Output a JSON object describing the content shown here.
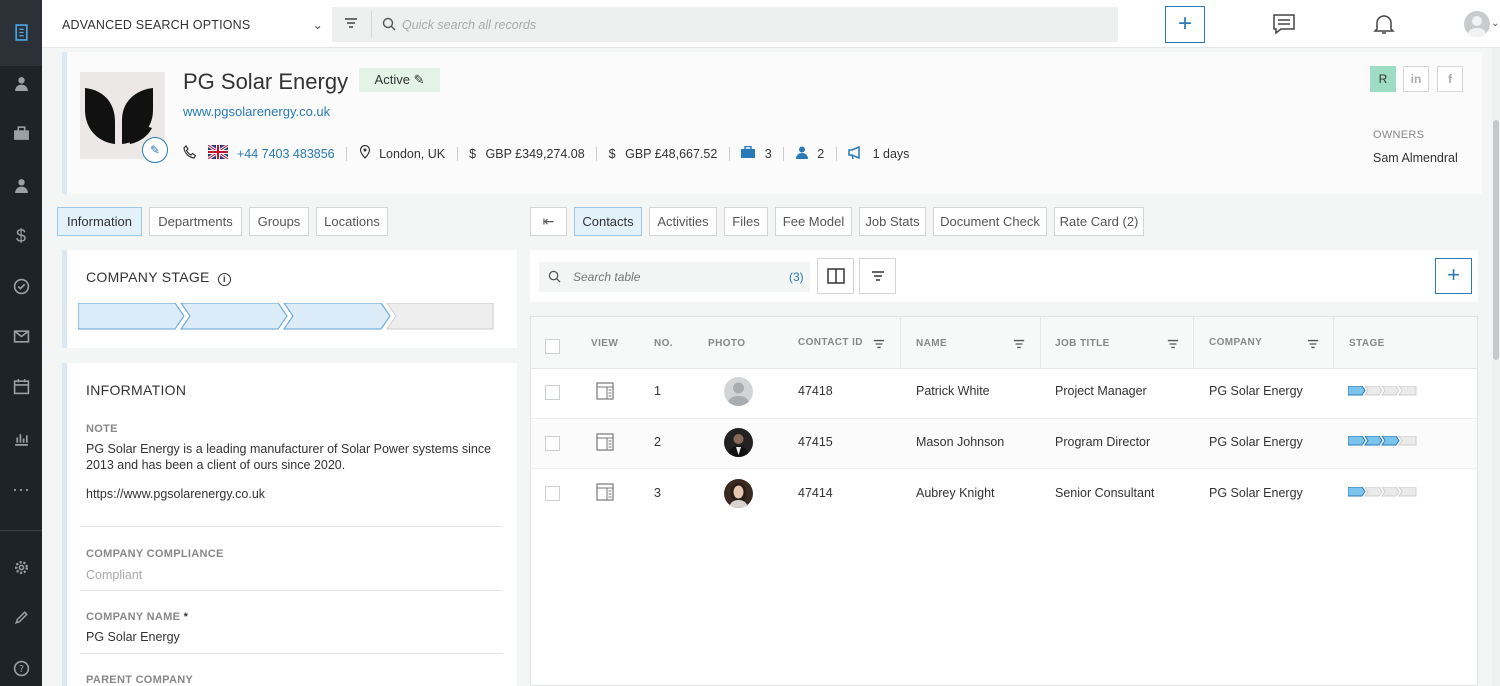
{
  "topbar": {
    "advanced_label": "ADVANCED SEARCH OPTIONS",
    "search_placeholder": "Quick search all records"
  },
  "company": {
    "name": "PG Solar Energy",
    "status": "Active",
    "website": "www.pgsolarenergy.co.uk",
    "phone": "+44 7403 483856",
    "location": "London, UK",
    "value1": "GBP £349,274.08",
    "value2": "GBP £48,667.52",
    "jobs_count": "3",
    "contacts_count": "2",
    "days": "1 days",
    "social_r": "R",
    "social_li": "in",
    "social_fb": "f",
    "owners_label": "OWNERS",
    "owner": "Sam Almendral"
  },
  "left_tabs": [
    "Information",
    "Departments",
    "Groups",
    "Locations"
  ],
  "right_tabs": [
    "Contacts",
    "Activities",
    "Files",
    "Fee Model",
    "Job Stats",
    "Document Check",
    "Rate Card (2)"
  ],
  "stage": {
    "title": "COMPANY STAGE",
    "filled": 3,
    "total": 4
  },
  "information": {
    "title": "INFORMATION",
    "note_label": "NOTE",
    "note_line1": "PG Solar Energy is a leading manufacturer of Solar Power systems since",
    "note_line2": "2013 and has been a client of ours since 2020.",
    "note_link": "https://www.pgsolarenergy.co.uk",
    "compliance_label": "COMPANY COMPLIANCE",
    "compliance_value": "Compliant",
    "cname_label": "COMPANY NAME",
    "cname_required": "*",
    "cname_value": "PG Solar Energy",
    "parent_label": "PARENT COMPANY"
  },
  "table": {
    "search_placeholder": "Search table",
    "count": "(3)",
    "columns": [
      "VIEW",
      "NO.",
      "PHOTO",
      "CONTACT ID",
      "NAME",
      "JOB TITLE",
      "COMPANY",
      "STAGE"
    ],
    "rows": [
      {
        "no": "1",
        "id": "47418",
        "name": "Patrick White",
        "title": "Project Manager",
        "company": "PG Solar Energy",
        "stage": 1
      },
      {
        "no": "2",
        "id": "47415",
        "name": "Mason Johnson",
        "title": "Program Director",
        "company": "PG Solar Energy",
        "stage": 3
      },
      {
        "no": "3",
        "id": "47414",
        "name": "Aubrey Knight",
        "title": "Senior Consultant",
        "company": "PG Solar Energy",
        "stage": 1
      }
    ]
  },
  "colors": {
    "accent": "#2a7ab8",
    "sidebar": "#1e2327",
    "stage_fill": "#dcebf8"
  }
}
